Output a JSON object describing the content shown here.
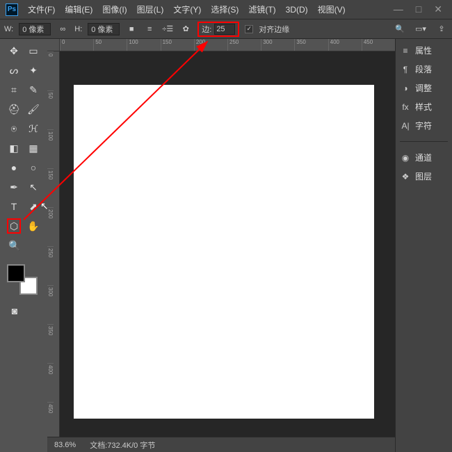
{
  "menu": {
    "file": "文件(F)",
    "edit": "编辑(E)",
    "image": "图像(I)",
    "layer": "图层(L)",
    "type": "文字(Y)",
    "select": "选择(S)",
    "filter": "滤镜(T)",
    "threed": "3D(D)",
    "view": "视图(V)"
  },
  "optbar": {
    "w_label": "W:",
    "w_value": "0 像素",
    "link": "∞",
    "h_label": "H:",
    "h_value": "0 像素",
    "sides_label": "边:",
    "sides_value": "25",
    "align_label": "对齐边缘"
  },
  "panels": {
    "prop": "属性",
    "para": "段落",
    "adjust": "调整",
    "style": "样式",
    "char": "字符",
    "channel": "通道",
    "layer": "图层"
  },
  "status": {
    "zoom": "83.6%",
    "doc": "文档:732.4K/0 字节"
  },
  "rulers": {
    "h": [
      "0",
      "50",
      "100",
      "150",
      "200",
      "250",
      "300",
      "350",
      "400",
      "450"
    ],
    "v": [
      "0",
      "50",
      "100",
      "150",
      "200",
      "250",
      "300",
      "350",
      "400",
      "450"
    ]
  }
}
